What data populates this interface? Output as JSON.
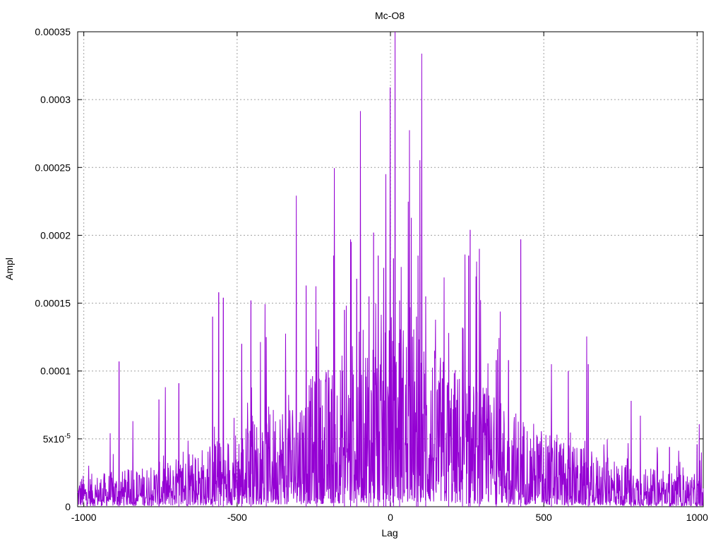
{
  "chart_data": {
    "type": "line",
    "title": "Mc-O8",
    "xlabel": "Lag",
    "ylabel": "Ampl",
    "xlim": [
      -1020,
      1020
    ],
    "ylim": [
      0,
      0.00035
    ],
    "grid": true,
    "legend": "none",
    "series_color": "#9400d3",
    "x_ticks": [
      {
        "value": -1000,
        "label": "-1000"
      },
      {
        "value": -500,
        "label": "-500"
      },
      {
        "value": 0,
        "label": "0"
      },
      {
        "value": 500,
        "label": "500"
      },
      {
        "value": 1000,
        "label": "1000"
      }
    ],
    "y_ticks": [
      {
        "value": 0,
        "label": "0"
      },
      {
        "value": 5e-05,
        "label": "5x10",
        "sup": "-5"
      },
      {
        "value": 0.0001,
        "label": "0.0001"
      },
      {
        "value": 0.00015,
        "label": "0.00015"
      },
      {
        "value": 0.0002,
        "label": "0.0002"
      },
      {
        "value": 0.00025,
        "label": "0.00025"
      },
      {
        "value": 0.0003,
        "label": "0.0003"
      },
      {
        "value": 0.00035,
        "label": "0.00035"
      }
    ],
    "series": [
      {
        "peaks": [
          {
            "x": -885,
            "y": 0.000107
          },
          {
            "x": -755,
            "y": 7.9e-05
          },
          {
            "x": -690,
            "y": 9.1e-05
          },
          {
            "x": -580,
            "y": 0.00014
          },
          {
            "x": -560,
            "y": 0.000158
          },
          {
            "x": -545,
            "y": 0.000154
          },
          {
            "x": -485,
            "y": 0.00012
          },
          {
            "x": -455,
            "y": 0.000152
          },
          {
            "x": -405,
            "y": 0.000125
          },
          {
            "x": -275,
            "y": 0.000163
          },
          {
            "x": -240,
            "y": 0.000118
          },
          {
            "x": -185,
            "y": 0.000185
          },
          {
            "x": -150,
            "y": 0.000145
          },
          {
            "x": -130,
            "y": 0.000197
          },
          {
            "x": -110,
            "y": 0.000168
          },
          {
            "x": -70,
            "y": 0.000155
          },
          {
            "x": -55,
            "y": 0.000202
          },
          {
            "x": -40,
            "y": 0.000185
          },
          {
            "x": -22,
            "y": 0.000176
          },
          {
            "x": -15,
            "y": 0.000245
          },
          {
            "x": -1,
            "y": 0.000309
          },
          {
            "x": 10,
            "y": 0.000183
          },
          {
            "x": 30,
            "y": 0.000152
          },
          {
            "x": 85,
            "y": 0.00014
          },
          {
            "x": 90,
            "y": 0.000185
          },
          {
            "x": 115,
            "y": 0.000155
          },
          {
            "x": 190,
            "y": 0.000128
          },
          {
            "x": 235,
            "y": 0.000132
          },
          {
            "x": 255,
            "y": 0.000185
          },
          {
            "x": 260,
            "y": 0.000204
          },
          {
            "x": 290,
            "y": 0.00019
          },
          {
            "x": 345,
            "y": 0.000108
          },
          {
            "x": 385,
            "y": 0.000108
          },
          {
            "x": 425,
            "y": 0.000197
          },
          {
            "x": 525,
            "y": 0.000105
          },
          {
            "x": 580,
            "y": 0.0001
          },
          {
            "x": 645,
            "y": 0.000105
          },
          {
            "x": 785,
            "y": 7.8e-05
          },
          {
            "x": 815,
            "y": 6.7e-05
          },
          {
            "x": 910,
            "y": 4.4e-05
          },
          {
            "x": 1000,
            "y": 4.6e-05
          }
        ]
      }
    ]
  }
}
